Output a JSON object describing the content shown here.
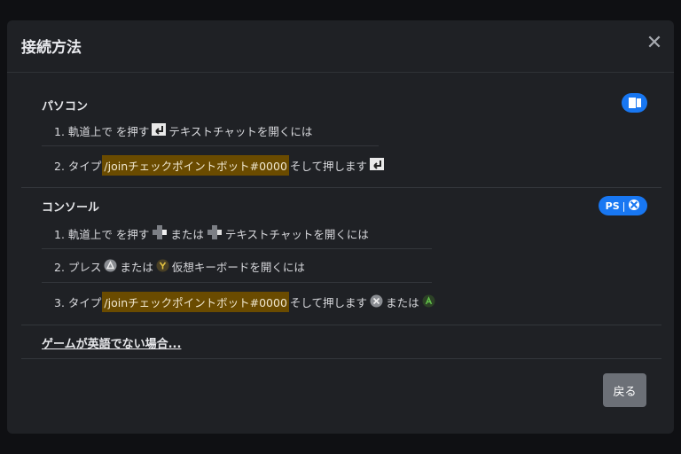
{
  "dialog": {
    "title": "接続方法",
    "close_icon": "close-icon"
  },
  "pc": {
    "heading": "パソコン",
    "platform_icon": "windows-icon",
    "step1": {
      "prefix": "1. 軌道上で を押す",
      "suffix": "テキストチャットを開くには",
      "key_icon": "enter-key-icon"
    },
    "step2": {
      "prefix": "2. タイプ",
      "code": "/joinチェックポイントボット#0000",
      "suffix": "そして押します",
      "key_icon": "enter-key-icon"
    }
  },
  "console": {
    "heading": "コンソール",
    "platform_icons": [
      "playstation-icon",
      "xbox-icon"
    ],
    "step1": {
      "prefix": "1. 軌道上で を押す",
      "mid": "または",
      "suffix": "テキストチャットを開くには"
    },
    "step2": {
      "prefix": "2. プレス",
      "mid": "または",
      "suffix": "仮想キーボードを開くには"
    },
    "step3": {
      "prefix": "3. タイプ",
      "code": "/joinチェックポイントボット#0000",
      "suffix": "そして押します",
      "mid": "または"
    }
  },
  "language_link": "ゲームが英語でない場合...",
  "back_button": "戻る",
  "colors": {
    "background": "#1f2125",
    "accent_blue": "#1877f2",
    "highlight": "#6a4b00",
    "button": "#6c7077"
  }
}
